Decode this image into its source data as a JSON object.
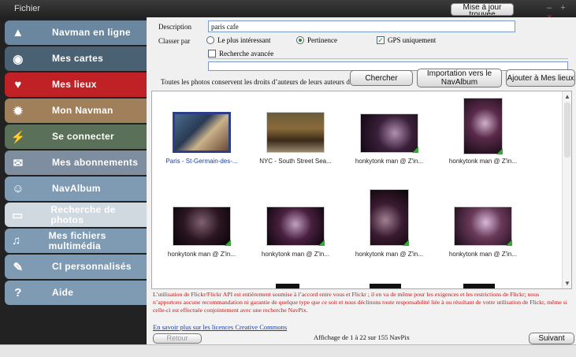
{
  "window": {
    "title": "Fichier",
    "update_label": "Mise à jour trouvée"
  },
  "sidebar": {
    "items": [
      {
        "label": "Navman en ligne",
        "icon": "navman-logo-icon",
        "color": "#6a879f"
      },
      {
        "label": "Mes cartes",
        "icon": "eye-icon",
        "color": "#4a6173"
      },
      {
        "label": "Mes lieux",
        "icon": "heart-icon",
        "color": "#c02127"
      },
      {
        "label": "Mon Navman",
        "icon": "gear-icon",
        "color": "#a0805a"
      },
      {
        "label": "Se connecter",
        "icon": "plug-icon",
        "color": "#5a7059"
      },
      {
        "label": "Mes abonnements",
        "icon": "envelope-icon",
        "color": "#7e8ea0"
      },
      {
        "label": "NavAlbum",
        "icon": "people-icon",
        "color": "#7f9bb4"
      },
      {
        "label": "Recherche de photos",
        "icon": "camera-icon",
        "color": "#d0d8e0"
      },
      {
        "label": "Mes fichiers multimédia",
        "icon": "music-note-icon",
        "color": "#7f9bb4"
      },
      {
        "label": "CI personnalisés",
        "icon": "edit-flag-icon",
        "color": "#7f9bb4"
      },
      {
        "label": "Aide",
        "icon": "question-icon",
        "color": "#7f9bb4"
      }
    ]
  },
  "search": {
    "description_label": "Description",
    "description_value": "paris cafe",
    "sort_label": "Classer par",
    "options": {
      "most_interesting": "Le plus intéressant",
      "relevance": "Pertinence",
      "gps_only": "GPS uniquement"
    },
    "advanced_label": "Recherche avancée",
    "rights_note": "Toutes les photos conservent les droits d’auteurs de leurs auteurs d’origine.",
    "buttons": {
      "search": "Chercher",
      "import": "Importation vers le NavAlbum",
      "add_places": "Ajouter à Mes lieux"
    }
  },
  "results": [
    {
      "caption": "Paris - St-Germain-des-...",
      "selected": true,
      "tone": "paris"
    },
    {
      "caption": "NYC - South Street Sea...",
      "selected": false,
      "tone": "nyc"
    },
    {
      "caption": "honkytonk man @ Z'in...",
      "selected": false,
      "tone": "dark1"
    },
    {
      "caption": "honkytonk man @ Z'in...",
      "selected": false,
      "tone": "dark2"
    },
    {
      "caption": "honkytonk man @ Z'in...",
      "selected": false,
      "tone": "dark3"
    },
    {
      "caption": "honkytonk man @ Z'in...",
      "selected": false,
      "tone": "dark4"
    },
    {
      "caption": "honkytonk man @ Z'in...",
      "selected": false,
      "tone": "dark5"
    },
    {
      "caption": "honkytonk man @ Z'in...",
      "selected": false,
      "tone": "dark6"
    }
  ],
  "disclaimer": "L’utilisation de Flickr/Flickr API est entièrement soumise à l’accord entre vous et Flickr ; il en va de même pour les exigences et les restrictions de Flickr; nous n’apportons aucune recommandation ni garantie de quelque type que ce soit et nous déclinons toute responsabilité liée à ou résultant de votre utilisation de Flickr, même si celle-ci est effectuée conjointement avec une recherche NavPix.",
  "cc_link": "En savoir plus sur les licences Creative Commons",
  "paging": {
    "back": "Retour",
    "info": "Affichage de 1 à 22 sur 155 NavPix",
    "next": "Suivant"
  }
}
